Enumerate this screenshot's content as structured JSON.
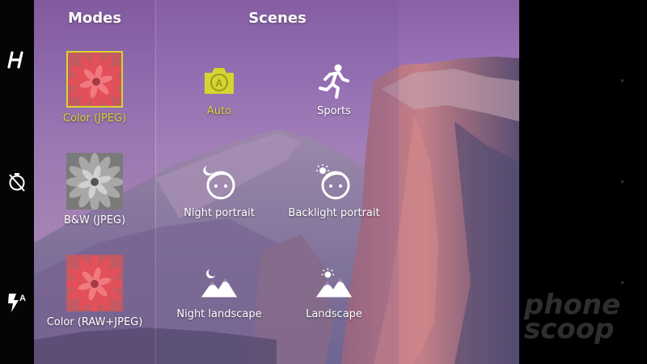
{
  "panel": {
    "modes_title": "Modes",
    "scenes_title": "Scenes"
  },
  "modes": [
    {
      "label": "Color (JPEG)",
      "selected": true
    },
    {
      "label": "B&W (JPEG)",
      "selected": false
    },
    {
      "label": "Color (RAW+JPEG)",
      "selected": false
    }
  ],
  "scenes": [
    {
      "label": "Auto",
      "icon": "camera-auto-icon",
      "selected": true
    },
    {
      "label": "Sports",
      "icon": "running-person-icon",
      "selected": false
    },
    {
      "label": "Night portrait",
      "icon": "night-portrait-icon",
      "selected": false
    },
    {
      "label": "Backlight portrait",
      "icon": "backlight-portrait-icon",
      "selected": false
    },
    {
      "label": "Night landscape",
      "icon": "night-landscape-icon",
      "selected": false
    },
    {
      "label": "Landscape",
      "icon": "landscape-icon",
      "selected": false
    }
  ],
  "rail": {
    "brand_icon": "hasselblad-h-icon",
    "timer_icon": "timer-off-icon",
    "flash_icon": "flash-auto-icon",
    "flash_badge": "A"
  },
  "colors": {
    "accent": "#d6d431",
    "text": "#ffffff"
  },
  "watermark": {
    "line1": "phone",
    "line2": "scoop"
  }
}
